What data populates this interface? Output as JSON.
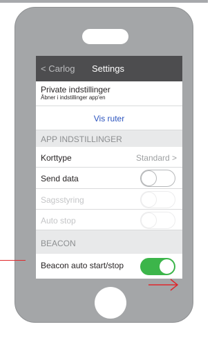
{
  "nav": {
    "back_label": "< Carlog",
    "title": "Settings"
  },
  "private": {
    "title": "Private indstillinger",
    "subtitle": "Åbner i indstillinger app'en"
  },
  "vis_ruter": {
    "label": "Vis ruter"
  },
  "section_app": {
    "label": "APP INDSTILLINGER"
  },
  "korttype": {
    "label": "Korttype",
    "value": "Standard >"
  },
  "send_data": {
    "label": "Send data",
    "state": "off"
  },
  "sagsstyring": {
    "label": "Sagsstyring",
    "state": "disabled"
  },
  "auto_stop": {
    "label": "Auto stop",
    "state": "disabled"
  },
  "section_beacon": {
    "label": "BEACON"
  },
  "beacon_auto": {
    "label": "Beacon auto start/stop",
    "state": "on"
  },
  "colors": {
    "toggle_on": "#3cb54a",
    "nav_bar": "#4d4d4f",
    "link": "#2a52be",
    "annotation": "#e0262a"
  }
}
